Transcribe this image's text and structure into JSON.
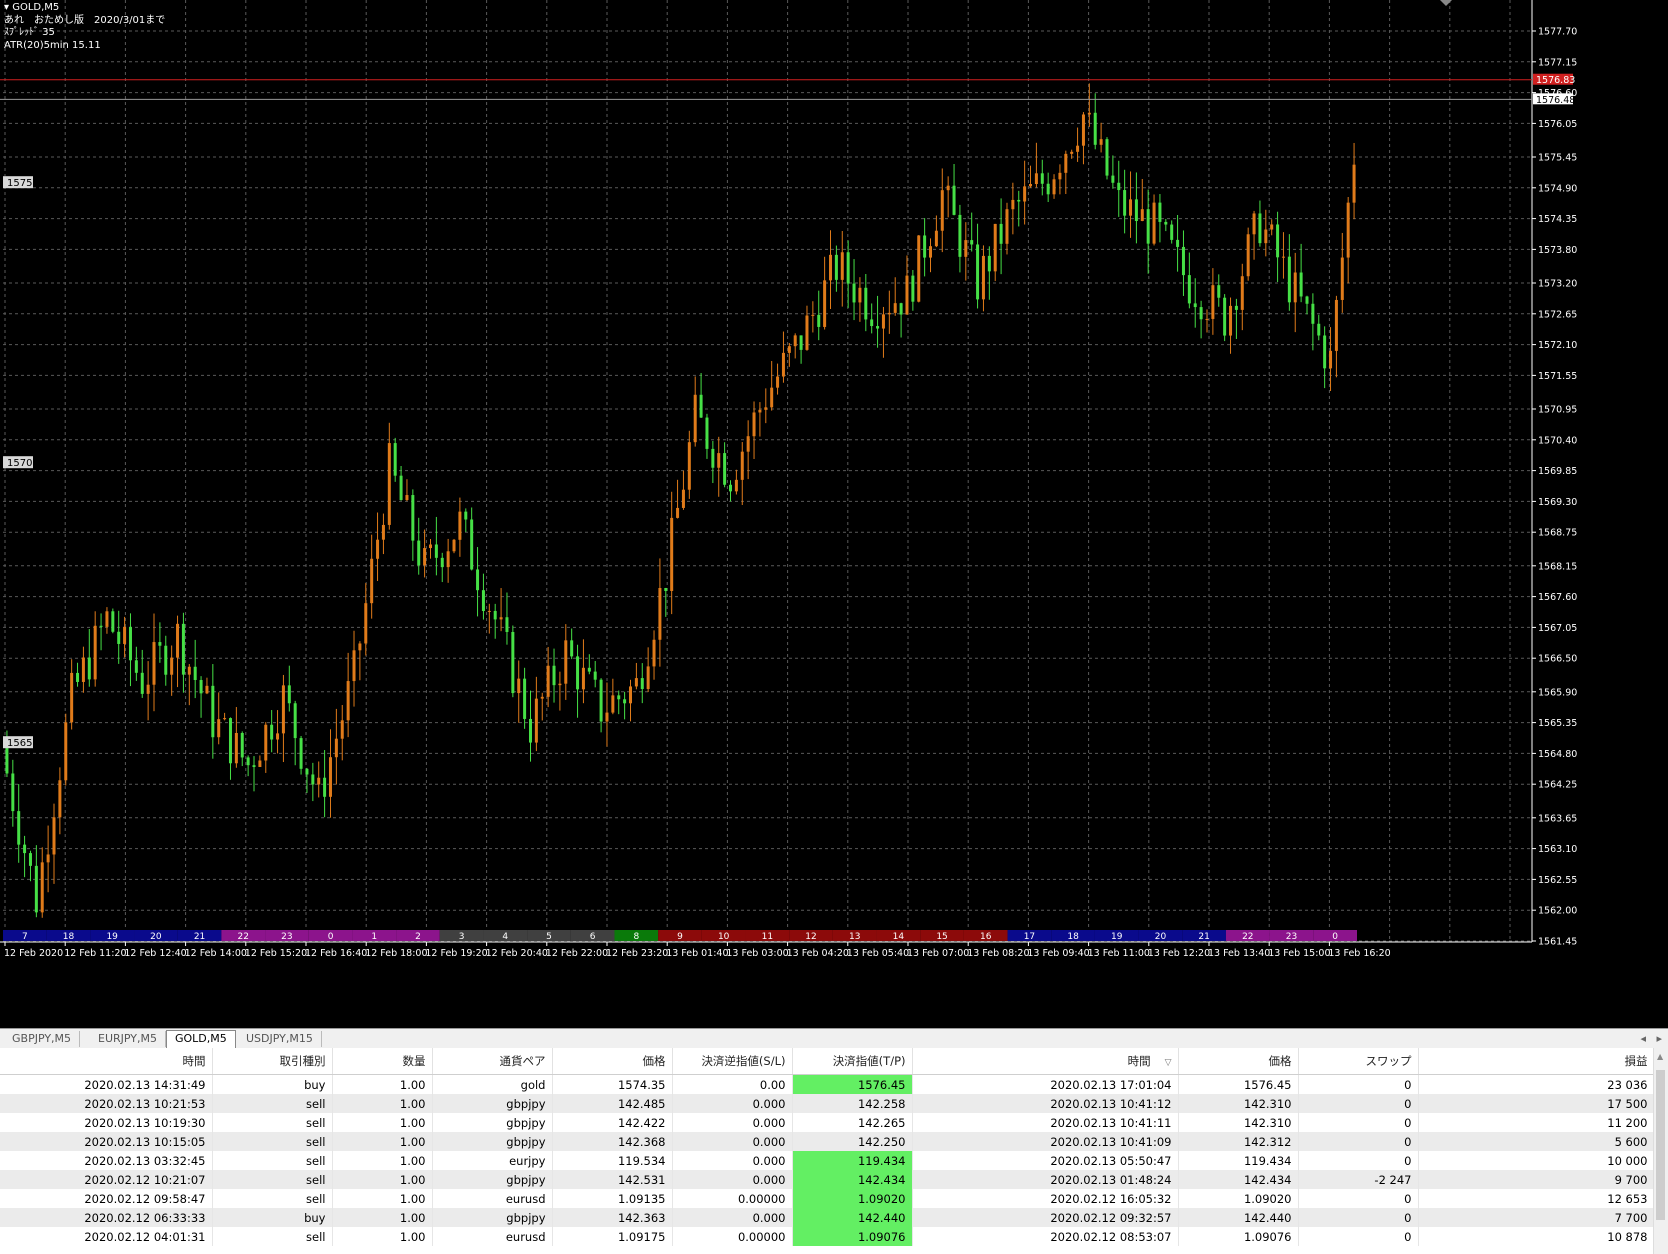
{
  "chart": {
    "symbol_title": "GOLD,M5",
    "info_line_1": "あれ　おためし版　2020/3/01まで",
    "info_line_2": "ｽﾌﾟﾚｯﾄﾞ 35",
    "info_line_3": "ATR(20)5min 15.11",
    "left_price_labels": [
      "1575",
      "1570",
      "1565"
    ],
    "current_price_label": "1576.83",
    "bid_price_label": "1576.48",
    "colors": {
      "background": "#000000",
      "grid": "#5a5a5a",
      "bull_candle": "#e07b1a",
      "bear_candle": "#46e046",
      "price_line": "#d02020",
      "label_bg": "#ffffff"
    },
    "session_bar": [
      {
        "label": "7",
        "color": "#0a0a8c"
      },
      {
        "label": "18",
        "color": "#0a0a8c"
      },
      {
        "label": "19",
        "color": "#0a0a8c"
      },
      {
        "label": "20",
        "color": "#0a0a8c"
      },
      {
        "label": "21",
        "color": "#0a0a8c"
      },
      {
        "label": "22",
        "color": "#8c148c"
      },
      {
        "label": "23",
        "color": "#8c148c"
      },
      {
        "label": "0",
        "color": "#8c148c"
      },
      {
        "label": "1",
        "color": "#8c148c"
      },
      {
        "label": "2",
        "color": "#8c148c"
      },
      {
        "label": "3",
        "color": "#404040"
      },
      {
        "label": "4",
        "color": "#404040"
      },
      {
        "label": "5",
        "color": "#404040"
      },
      {
        "label": "6",
        "color": "#404040"
      },
      {
        "label": "8",
        "color": "#0a7a0a"
      },
      {
        "label": "9",
        "color": "#8c0a0a"
      },
      {
        "label": "10",
        "color": "#8c0a0a"
      },
      {
        "label": "11",
        "color": "#8c0a0a"
      },
      {
        "label": "12",
        "color": "#8c0a0a"
      },
      {
        "label": "13",
        "color": "#8c0a0a"
      },
      {
        "label": "14",
        "color": "#8c0a0a"
      },
      {
        "label": "15",
        "color": "#8c0a0a"
      },
      {
        "label": "16",
        "color": "#8c0a0a"
      },
      {
        "label": "17",
        "color": "#0a0a8c"
      },
      {
        "label": "18",
        "color": "#0a0a8c"
      },
      {
        "label": "19",
        "color": "#0a0a8c"
      },
      {
        "label": "20",
        "color": "#0a0a8c"
      },
      {
        "label": "21",
        "color": "#0a0a8c"
      },
      {
        "label": "22",
        "color": "#8c148c"
      },
      {
        "label": "23",
        "color": "#8c148c"
      },
      {
        "label": "0",
        "color": "#8c148c"
      }
    ]
  },
  "chart_data": {
    "type": "candlestick",
    "symbol": "GOLD",
    "timeframe": "M5",
    "ylim": [
      1561.45,
      1577.7
    ],
    "y_ticks": [
      "1577.70",
      "1577.15",
      "1576.60",
      "1576.05",
      "1575.45",
      "1574.90",
      "1574.35",
      "1573.80",
      "1573.20",
      "1572.65",
      "1572.10",
      "1571.55",
      "1570.95",
      "1570.40",
      "1569.85",
      "1569.30",
      "1568.75",
      "1568.15",
      "1567.60",
      "1567.05",
      "1566.50",
      "1565.90",
      "1565.35",
      "1564.80",
      "1564.25",
      "1563.65",
      "1563.10",
      "1562.55",
      "1562.00",
      "1561.45"
    ],
    "x_ticks": [
      "12 Feb 2020",
      "12 Feb 11:20",
      "12 Feb 12:40",
      "12 Feb 14:00",
      "12 Feb 15:20",
      "12 Feb 16:40",
      "12 Feb 18:00",
      "12 Feb 19:20",
      "12 Feb 20:40",
      "12 Feb 22:00",
      "12 Feb 23:20",
      "13 Feb 01:40",
      "13 Feb 03:00",
      "13 Feb 04:20",
      "13 Feb 05:40",
      "13 Feb 07:00",
      "13 Feb 08:20",
      "13 Feb 09:40",
      "13 Feb 11:00",
      "13 Feb 12:20",
      "13 Feb 13:40",
      "13 Feb 15:00",
      "13 Feb 16:20"
    ],
    "current_price": 1576.83,
    "bid_price": 1576.48,
    "close_path": [
      [
        0,
        1564.9
      ],
      [
        6,
        1562.2
      ],
      [
        12,
        1565.8
      ],
      [
        18,
        1567.2
      ],
      [
        24,
        1566.1
      ],
      [
        30,
        1566.9
      ],
      [
        36,
        1565.4
      ],
      [
        42,
        1564.6
      ],
      [
        48,
        1565.8
      ],
      [
        54,
        1564.0
      ],
      [
        60,
        1566.2
      ],
      [
        66,
        1569.9
      ],
      [
        72,
        1568.1
      ],
      [
        78,
        1568.9
      ],
      [
        84,
        1567.2
      ],
      [
        90,
        1565.3
      ],
      [
        96,
        1566.6
      ],
      [
        102,
        1565.6
      ],
      [
        108,
        1566.0
      ],
      [
        113,
        1568.0
      ],
      [
        118,
        1570.8
      ],
      [
        124,
        1569.8
      ],
      [
        130,
        1571.2
      ],
      [
        136,
        1572.2
      ],
      [
        142,
        1573.5
      ],
      [
        148,
        1572.8
      ],
      [
        154,
        1573.0
      ],
      [
        160,
        1574.8
      ],
      [
        166,
        1573.2
      ],
      [
        172,
        1574.5
      ],
      [
        178,
        1575.1
      ],
      [
        184,
        1576.2
      ],
      [
        190,
        1574.6
      ],
      [
        196,
        1574.2
      ],
      [
        202,
        1573.2
      ],
      [
        208,
        1572.6
      ],
      [
        214,
        1574.3
      ],
      [
        220,
        1573.0
      ],
      [
        226,
        1571.8
      ],
      [
        230,
        1575.5
      ]
    ],
    "candle_count": 230
  },
  "tabs": [
    {
      "label": "GBPJPY,M5",
      "active": false
    },
    {
      "label": "EURJPY,M5",
      "active": false
    },
    {
      "label": "GOLD,M5",
      "active": true
    },
    {
      "label": "USDJPY,M15",
      "active": false
    }
  ],
  "table": {
    "headers": [
      "時間",
      "取引種別",
      "数量",
      "通貨ペア",
      "価格",
      "決済逆指値(S/L)",
      "決済指値(T/P)",
      "時間",
      "価格",
      "スワップ",
      "損益"
    ],
    "sort_indicator": "▽",
    "rows": [
      {
        "open_time": "2020.02.13 14:31:49",
        "type": "buy",
        "volume": "1.00",
        "symbol": "gold",
        "open_price": "1574.35",
        "sl": "0.00",
        "tp": "1576.45",
        "tp_hit": true,
        "close_time": "2020.02.13 17:01:04",
        "close_price": "1576.45",
        "swap": "0",
        "profit": "23 036"
      },
      {
        "open_time": "2020.02.13 10:21:53",
        "type": "sell",
        "volume": "1.00",
        "symbol": "gbpjpy",
        "open_price": "142.485",
        "sl": "0.000",
        "tp": "142.258",
        "tp_hit": false,
        "close_time": "2020.02.13 10:41:12",
        "close_price": "142.310",
        "swap": "0",
        "profit": "17 500"
      },
      {
        "open_time": "2020.02.13 10:19:30",
        "type": "sell",
        "volume": "1.00",
        "symbol": "gbpjpy",
        "open_price": "142.422",
        "sl": "0.000",
        "tp": "142.265",
        "tp_hit": false,
        "close_time": "2020.02.13 10:41:11",
        "close_price": "142.310",
        "swap": "0",
        "profit": "11 200"
      },
      {
        "open_time": "2020.02.13 10:15:05",
        "type": "sell",
        "volume": "1.00",
        "symbol": "gbpjpy",
        "open_price": "142.368",
        "sl": "0.000",
        "tp": "142.250",
        "tp_hit": false,
        "close_time": "2020.02.13 10:41:09",
        "close_price": "142.312",
        "swap": "0",
        "profit": "5 600"
      },
      {
        "open_time": "2020.02.13 03:32:45",
        "type": "sell",
        "volume": "1.00",
        "symbol": "eurjpy",
        "open_price": "119.534",
        "sl": "0.000",
        "tp": "119.434",
        "tp_hit": true,
        "close_time": "2020.02.13 05:50:47",
        "close_price": "119.434",
        "swap": "0",
        "profit": "10 000"
      },
      {
        "open_time": "2020.02.12 10:21:07",
        "type": "sell",
        "volume": "1.00",
        "symbol": "gbpjpy",
        "open_price": "142.531",
        "sl": "0.000",
        "tp": "142.434",
        "tp_hit": true,
        "close_time": "2020.02.13 01:48:24",
        "close_price": "142.434",
        "swap": "-2 247",
        "profit": "9 700"
      },
      {
        "open_time": "2020.02.12 09:58:47",
        "type": "sell",
        "volume": "1.00",
        "symbol": "eurusd",
        "open_price": "1.09135",
        "sl": "0.00000",
        "tp": "1.09020",
        "tp_hit": true,
        "close_time": "2020.02.12 16:05:32",
        "close_price": "1.09020",
        "swap": "0",
        "profit": "12 653"
      },
      {
        "open_time": "2020.02.12 06:33:33",
        "type": "buy",
        "volume": "1.00",
        "symbol": "gbpjpy",
        "open_price": "142.363",
        "sl": "0.000",
        "tp": "142.440",
        "tp_hit": true,
        "close_time": "2020.02.12 09:32:57",
        "close_price": "142.440",
        "swap": "0",
        "profit": "7 700"
      },
      {
        "open_time": "2020.02.12 04:01:31",
        "type": "sell",
        "volume": "1.00",
        "symbol": "eurusd",
        "open_price": "1.09175",
        "sl": "0.00000",
        "tp": "1.09076",
        "tp_hit": true,
        "close_time": "2020.02.12 08:53:07",
        "close_price": "1.09076",
        "swap": "0",
        "profit": "10 878"
      }
    ]
  }
}
